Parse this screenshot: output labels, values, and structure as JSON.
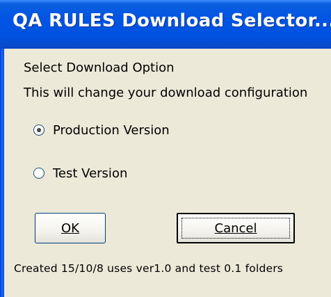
{
  "window": {
    "title": "QA RULES Download Selector..."
  },
  "dialog": {
    "heading": "Select Download Option",
    "description": "This will change your download configuration",
    "options": [
      {
        "label": "Production Version",
        "selected": true
      },
      {
        "label": "Test Version",
        "selected": false
      }
    ],
    "buttons": {
      "ok_label": "OK",
      "cancel_label": "Cancel"
    },
    "footer_note": "Created 15/10/8 uses ver1.0 and test 0.1 folders"
  },
  "colors": {
    "titlebar": "#0054e3",
    "dialog_background": "#ece9d8",
    "title_text": "#ffffff"
  }
}
